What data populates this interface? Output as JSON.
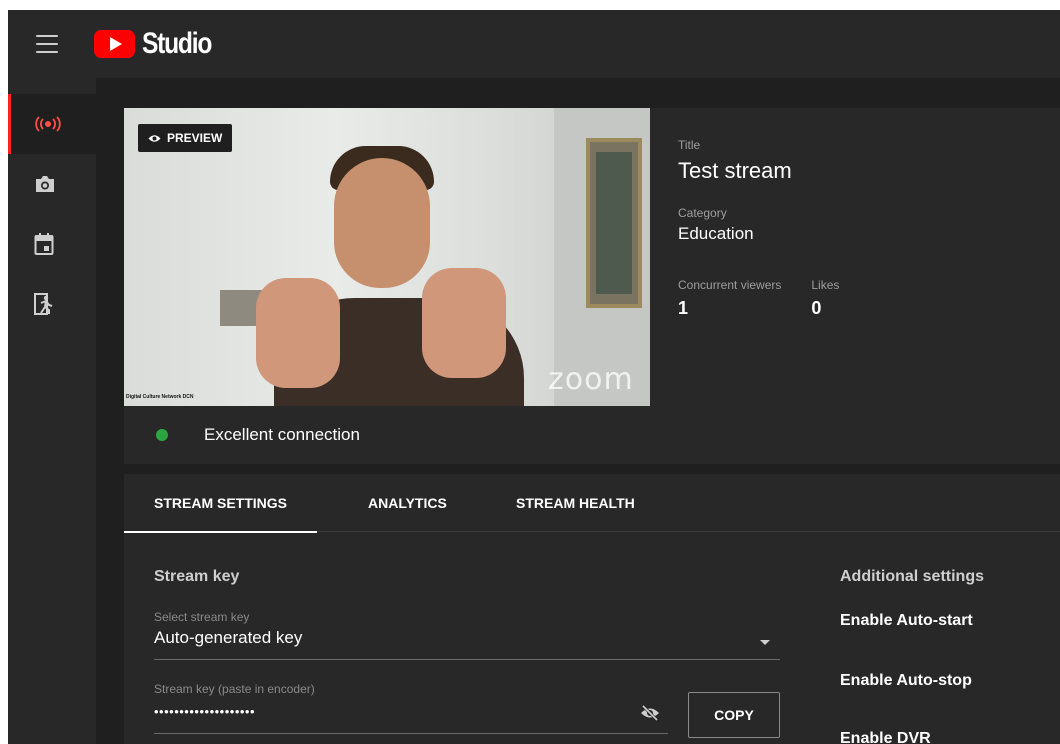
{
  "app": {
    "name": "Studio"
  },
  "preview": {
    "badge": "PREVIEW",
    "video_watermark": "zoom",
    "video_caption": "Digital Culture Network DCN"
  },
  "stream_info": {
    "title_label": "Title",
    "title": "Test stream",
    "category_label": "Category",
    "category": "Education",
    "viewers_label": "Concurrent viewers",
    "viewers": "1",
    "likes_label": "Likes",
    "likes": "0"
  },
  "connection": {
    "status": "Excellent connection",
    "status_color": "#2ba640"
  },
  "tabs": [
    {
      "label": "STREAM SETTINGS",
      "active": true
    },
    {
      "label": "ANALYTICS",
      "active": false
    },
    {
      "label": "STREAM HEALTH",
      "active": false
    }
  ],
  "stream_key": {
    "section_title": "Stream key",
    "select_label": "Select stream key",
    "select_value": "Auto-generated key",
    "key_label": "Stream key (paste in encoder)",
    "key_value": "••••••••••••••••••••",
    "copy_label": "COPY"
  },
  "additional": {
    "section_title": "Additional settings",
    "items": [
      "Enable Auto-start",
      "Enable Auto-stop",
      "Enable DVR"
    ]
  },
  "rail": {
    "items": [
      "live-icon",
      "camera-icon",
      "calendar-icon",
      "manage-icon"
    ]
  },
  "colors": {
    "accent": "#ff0000",
    "live": "#ff4e45"
  }
}
